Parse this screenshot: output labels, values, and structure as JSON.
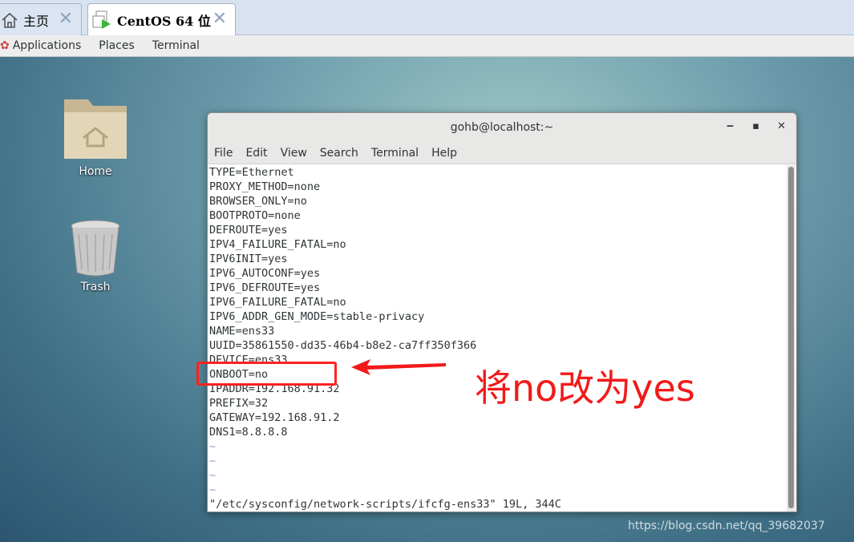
{
  "tabs": [
    {
      "label": "主页",
      "icon": "home-icon"
    },
    {
      "label": "CentOS 64 位",
      "icon": "vm-icon"
    }
  ],
  "menubar": {
    "items": [
      "Applications",
      "Places",
      "Terminal"
    ]
  },
  "desktop": {
    "icons": [
      {
        "label": "Home",
        "icon": "folder-home-icon"
      },
      {
        "label": "Trash",
        "icon": "trash-icon"
      }
    ]
  },
  "window": {
    "title": "gohb@localhost:~",
    "menu": [
      "File",
      "Edit",
      "View",
      "Search",
      "Terminal",
      "Help"
    ],
    "lines": [
      "TYPE=Ethernet",
      "PROXY_METHOD=none",
      "BROWSER_ONLY=no",
      "BOOTPROTO=none",
      "DEFROUTE=yes",
      "IPV4_FAILURE_FATAL=no",
      "IPV6INIT=yes",
      "IPV6_AUTOCONF=yes",
      "IPV6_DEFROUTE=yes",
      "IPV6_FAILURE_FATAL=no",
      "IPV6_ADDR_GEN_MODE=stable-privacy",
      "NAME=ens33",
      "UUID=35861550-dd35-46b4-b8e2-ca7ff350f366",
      "DEVICE=ens33",
      "ONBOOT=no",
      "IPADDR=192.168.91.32",
      "PREFIX=32",
      "GATEWAY=192.168.91.2",
      "DNS1=8.8.8.8"
    ],
    "tildes": [
      "~",
      "~",
      "~",
      "~"
    ],
    "status": "\"/etc/sysconfig/network-scripts/ifcfg-ens33\" 19L, 344C"
  },
  "annotation": {
    "text": "将no改为yes",
    "color": "#f21a1a"
  },
  "watermark": "https://blog.csdn.net/qq_39682037"
}
